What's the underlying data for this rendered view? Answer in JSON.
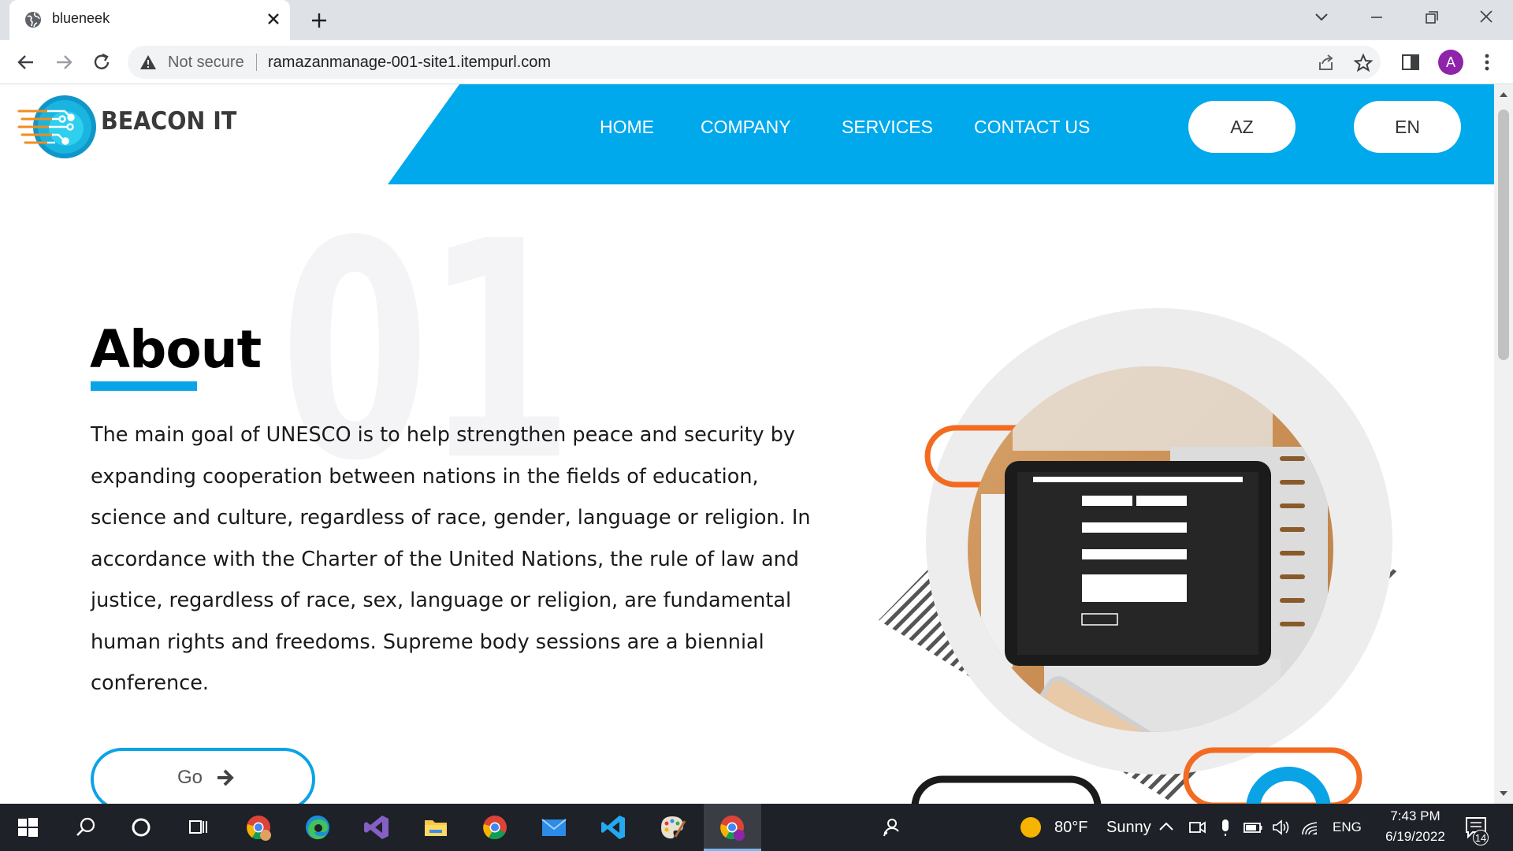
{
  "browser": {
    "tab_title": "blueneek",
    "security_label": "Not secure",
    "url": "ramazanmanage-001-site1.itempurl.com",
    "profile_initial": "A"
  },
  "site": {
    "brand": "BEACON IT",
    "nav": [
      "HOME",
      "COMPANY",
      "SERVICES",
      "CONTACT US"
    ],
    "languages": [
      "AZ",
      "EN"
    ],
    "accent_color": "#00a8ec"
  },
  "about": {
    "section_number": "01",
    "title": "About",
    "body": "The main goal of UNESCO is to help strengthen peace and security by expanding cooperation between nations in the fields of education, science and culture, regardless of race, gender, language or religion. In accordance with the Charter of the United Nations, the rule of law and justice, regardless of race, sex, language or religion, are fundamental human rights and freedoms. Supreme body sessions are a biennial conference.",
    "button_label": "Go"
  },
  "taskbar": {
    "weather_temp": "80°F",
    "weather_desc": "Sunny",
    "language": "ENG",
    "time": "7:43 PM",
    "date": "6/19/2022",
    "notification_count": "14"
  }
}
